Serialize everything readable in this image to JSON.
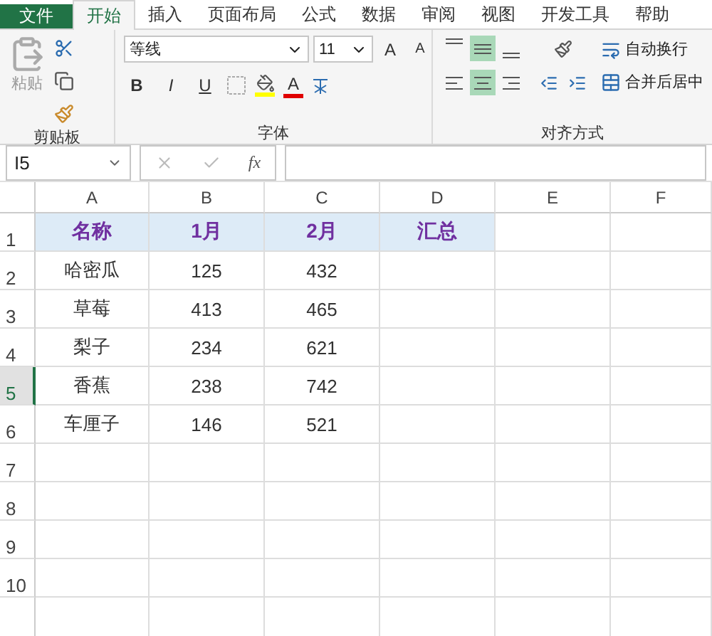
{
  "tabs": [
    {
      "label": "文件",
      "kind": "file",
      "selected": false
    },
    {
      "label": "开始",
      "kind": "tab",
      "selected": true
    },
    {
      "label": "插入",
      "kind": "tab",
      "selected": false
    },
    {
      "label": "页面布局",
      "kind": "tab",
      "selected": false
    },
    {
      "label": "公式",
      "kind": "tab",
      "selected": false
    },
    {
      "label": "数据",
      "kind": "tab",
      "selected": false
    },
    {
      "label": "审阅",
      "kind": "tab",
      "selected": false
    },
    {
      "label": "视图",
      "kind": "tab",
      "selected": false
    },
    {
      "label": "开发工具",
      "kind": "tab",
      "selected": false
    },
    {
      "label": "帮助",
      "kind": "tab",
      "selected": false
    }
  ],
  "ribbon": {
    "clipboard": {
      "paste_label": "粘贴",
      "title": "剪贴板"
    },
    "font": {
      "font_name": "等线",
      "font_size": "11",
      "grow": "A",
      "shrink": "A",
      "bold": "B",
      "italic": "I",
      "underline": "U",
      "font_color": "A",
      "title": "字体"
    },
    "alignment": {
      "vertical": [
        {
          "selected": false
        },
        {
          "selected": true
        },
        {
          "selected": false
        }
      ],
      "horizontal": [
        {
          "selected": false
        },
        {
          "selected": true
        },
        {
          "selected": false
        }
      ],
      "wrap": "自动换行",
      "merge": "合并后居中",
      "title": "对齐方式"
    }
  },
  "formula_bar": {
    "name_box": "I5",
    "fx": "fx"
  },
  "sheet": {
    "columns": [
      {
        "label": "A"
      },
      {
        "label": "B"
      },
      {
        "label": "C"
      },
      {
        "label": "D"
      },
      {
        "label": "E"
      },
      {
        "label": "F"
      }
    ],
    "rows": [
      {
        "number": "1",
        "kind": "header",
        "selected": false,
        "cells": [
          "名称",
          "1月",
          "2月",
          "汇总"
        ]
      },
      {
        "number": "2",
        "kind": "data",
        "selected": false,
        "cells": [
          "哈密瓜",
          "125",
          "432"
        ]
      },
      {
        "number": "3",
        "kind": "data",
        "selected": false,
        "cells": [
          "草莓",
          "413",
          "465"
        ]
      },
      {
        "number": "4",
        "kind": "data",
        "selected": false,
        "cells": [
          "梨子",
          "234",
          "621"
        ]
      },
      {
        "number": "5",
        "kind": "data",
        "selected": true,
        "cells": [
          "香蕉",
          "238",
          "742"
        ]
      },
      {
        "number": "6",
        "kind": "data",
        "selected": false,
        "cells": [
          "车厘子",
          "146",
          "521"
        ]
      },
      {
        "number": "7",
        "kind": "data",
        "selected": false,
        "cells": []
      },
      {
        "number": "8",
        "kind": "data",
        "selected": false,
        "cells": []
      },
      {
        "number": "9",
        "kind": "data",
        "selected": false,
        "cells": []
      },
      {
        "number": "10",
        "kind": "data",
        "selected": false,
        "cells": []
      }
    ]
  }
}
